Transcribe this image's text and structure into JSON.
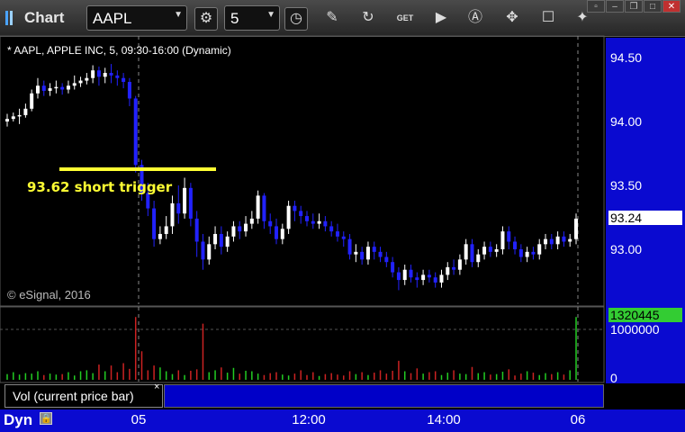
{
  "toolbar": {
    "app_title": "Chart",
    "symbol": "AAPL",
    "interval": "5"
  },
  "chart_title": "* AAPL, APPLE INC, 5, 09:30-16:00 (Dynamic)",
  "watermark": "© eSignal, 2016",
  "annotation": "93.62 short trigger",
  "price_axis": {
    "ticks": [
      "94.50",
      "94.00",
      "93.50",
      "93.00"
    ],
    "last_price": "93.24"
  },
  "volume_axis": {
    "ticks": [
      "1000000",
      "0"
    ],
    "last_volume": "1320445"
  },
  "volume_panel_label": "Vol (current price bar)",
  "volume_close": "×",
  "time_axis": {
    "ticks": [
      "05",
      "12:00",
      "14:00",
      "06"
    ]
  },
  "footer": {
    "dyn": "Dyn"
  },
  "colors": {
    "up": "#ffffff",
    "down": "#2222ff",
    "trigger_line": "#ffff33",
    "vol_up": "#22cc22",
    "vol_down": "#cc2222",
    "axis_bg": "#0a0ad0"
  },
  "chart_data": {
    "type": "candlestick",
    "title": "* AAPL, APPLE INC, 5, 09:30-16:00 (Dynamic)",
    "symbol": "AAPL",
    "interval": "5",
    "ylim": [
      92.6,
      94.6
    ],
    "yticks": [
      94.5,
      94.0,
      93.5,
      93.0
    ],
    "last_price": 93.24,
    "trigger": {
      "price": 93.62,
      "label": "93.62 short trigger"
    },
    "volume_last": 1320445,
    "volume_ticks": [
      1000000,
      0
    ],
    "time_ticks": [
      "05",
      "12:00",
      "14:00",
      "06"
    ],
    "candles": [
      [
        94.0,
        94.02,
        93.96,
        94.06
      ],
      [
        94.02,
        94.04,
        94.0,
        94.07
      ],
      [
        94.04,
        94.05,
        93.98,
        94.1
      ],
      [
        94.05,
        94.1,
        94.03,
        94.14
      ],
      [
        94.1,
        94.22,
        94.08,
        94.25
      ],
      [
        94.22,
        94.28,
        94.18,
        94.34
      ],
      [
        94.28,
        94.24,
        94.2,
        94.32
      ],
      [
        94.24,
        94.26,
        94.2,
        94.3
      ],
      [
        94.26,
        94.27,
        94.22,
        94.32
      ],
      [
        94.27,
        94.25,
        94.21,
        94.3
      ],
      [
        94.25,
        94.28,
        94.22,
        94.32
      ],
      [
        94.28,
        94.3,
        94.25,
        94.36
      ],
      [
        94.3,
        94.32,
        94.27,
        94.35
      ],
      [
        94.32,
        94.34,
        94.29,
        94.38
      ],
      [
        94.34,
        94.4,
        94.3,
        94.44
      ],
      [
        94.4,
        94.35,
        94.28,
        94.43
      ],
      [
        94.35,
        94.38,
        94.3,
        94.42
      ],
      [
        94.38,
        94.36,
        94.3,
        94.45
      ],
      [
        94.36,
        94.34,
        94.28,
        94.4
      ],
      [
        94.34,
        94.31,
        94.26,
        94.38
      ],
      [
        94.31,
        94.18,
        94.12,
        94.34
      ],
      [
        94.18,
        93.66,
        93.6,
        94.2
      ],
      [
        93.66,
        93.44,
        93.38,
        93.7
      ],
      [
        93.44,
        93.32,
        93.26,
        93.52
      ],
      [
        93.32,
        93.08,
        93.02,
        93.38
      ],
      [
        93.08,
        93.12,
        93.04,
        93.18
      ],
      [
        93.12,
        93.18,
        93.08,
        93.26
      ],
      [
        93.18,
        93.36,
        93.12,
        93.42
      ],
      [
        93.36,
        93.28,
        93.2,
        93.5
      ],
      [
        93.28,
        93.48,
        93.24,
        93.56
      ],
      [
        93.48,
        93.24,
        93.18,
        93.52
      ],
      [
        93.24,
        93.06,
        92.94,
        93.3
      ],
      [
        93.06,
        92.92,
        92.84,
        93.12
      ],
      [
        92.92,
        93.04,
        92.88,
        93.1
      ],
      [
        93.04,
        93.12,
        93.0,
        93.18
      ],
      [
        93.12,
        93.02,
        92.96,
        93.18
      ],
      [
        93.02,
        93.1,
        92.98,
        93.14
      ],
      [
        93.1,
        93.18,
        93.06,
        93.22
      ],
      [
        93.18,
        93.14,
        93.08,
        93.22
      ],
      [
        93.14,
        93.2,
        93.1,
        93.26
      ],
      [
        93.2,
        93.24,
        93.16,
        93.3
      ],
      [
        93.24,
        93.42,
        93.2,
        93.46
      ],
      [
        93.42,
        93.22,
        93.16,
        93.44
      ],
      [
        93.22,
        93.18,
        93.12,
        93.28
      ],
      [
        93.18,
        93.08,
        93.04,
        93.24
      ],
      [
        93.08,
        93.16,
        93.04,
        93.2
      ],
      [
        93.16,
        93.34,
        93.12,
        93.38
      ],
      [
        93.34,
        93.3,
        93.22,
        93.38
      ],
      [
        93.3,
        93.26,
        93.2,
        93.34
      ],
      [
        93.26,
        93.22,
        93.18,
        93.3
      ],
      [
        93.22,
        93.2,
        93.16,
        93.28
      ],
      [
        93.2,
        93.22,
        93.16,
        93.28
      ],
      [
        93.22,
        93.18,
        93.14,
        93.26
      ],
      [
        93.18,
        93.14,
        93.1,
        93.22
      ],
      [
        93.14,
        93.1,
        93.06,
        93.2
      ],
      [
        93.1,
        93.08,
        93.02,
        93.14
      ],
      [
        93.08,
        92.96,
        92.92,
        93.12
      ],
      [
        92.96,
        92.98,
        92.9,
        93.04
      ],
      [
        92.98,
        92.92,
        92.88,
        93.02
      ],
      [
        92.92,
        93.02,
        92.88,
        93.06
      ],
      [
        93.02,
        92.98,
        92.92,
        93.06
      ],
      [
        92.98,
        92.94,
        92.9,
        93.02
      ],
      [
        92.94,
        92.9,
        92.86,
        92.98
      ],
      [
        92.9,
        92.82,
        92.78,
        92.94
      ],
      [
        92.82,
        92.76,
        92.68,
        92.86
      ],
      [
        92.76,
        92.84,
        92.72,
        92.88
      ],
      [
        92.84,
        92.78,
        92.74,
        92.88
      ],
      [
        92.78,
        92.76,
        92.7,
        92.82
      ],
      [
        92.76,
        92.8,
        92.72,
        92.84
      ],
      [
        92.8,
        92.78,
        92.74,
        92.84
      ],
      [
        92.78,
        92.74,
        92.7,
        92.82
      ],
      [
        92.74,
        92.8,
        92.7,
        92.84
      ],
      [
        92.8,
        92.86,
        92.76,
        92.9
      ],
      [
        92.86,
        92.84,
        92.8,
        92.92
      ],
      [
        92.84,
        92.92,
        92.8,
        92.96
      ],
      [
        92.92,
        93.04,
        92.88,
        93.08
      ],
      [
        93.04,
        92.9,
        92.86,
        93.08
      ],
      [
        92.9,
        92.96,
        92.86,
        93.0
      ],
      [
        92.96,
        93.02,
        92.92,
        93.06
      ],
      [
        93.02,
        92.98,
        92.94,
        93.06
      ],
      [
        92.98,
        93.0,
        92.94,
        93.04
      ],
      [
        93.0,
        93.14,
        92.96,
        93.18
      ],
      [
        93.14,
        93.06,
        93.0,
        93.18
      ],
      [
        93.06,
        93.0,
        92.96,
        93.1
      ],
      [
        93.0,
        92.94,
        92.9,
        93.04
      ],
      [
        92.94,
        92.98,
        92.9,
        93.02
      ],
      [
        92.98,
        92.96,
        92.92,
        93.02
      ],
      [
        92.96,
        93.04,
        92.92,
        93.08
      ],
      [
        93.04,
        93.08,
        93.0,
        93.12
      ],
      [
        93.08,
        93.04,
        93.0,
        93.12
      ],
      [
        93.04,
        93.1,
        93.0,
        93.14
      ],
      [
        93.1,
        93.06,
        93.02,
        93.14
      ],
      [
        93.06,
        93.08,
        93.02,
        93.12
      ],
      [
        93.08,
        93.24,
        93.04,
        93.28
      ]
    ],
    "volumes": [
      120000,
      160000,
      110000,
      140000,
      130000,
      180000,
      100000,
      130000,
      110000,
      120000,
      160000,
      90000,
      180000,
      200000,
      140000,
      320000,
      180000,
      300000,
      160000,
      350000,
      230000,
      1320000,
      600000,
      200000,
      300000,
      260000,
      180000,
      120000,
      200000,
      100000,
      190000,
      220000,
      1180000,
      160000,
      200000,
      260000,
      150000,
      250000,
      130000,
      190000,
      180000,
      130000,
      100000,
      140000,
      160000,
      110000,
      90000,
      130000,
      200000,
      100000,
      160000,
      80000,
      120000,
      140000,
      110000,
      90000,
      180000,
      120000,
      160000,
      100000,
      150000,
      200000,
      130000,
      190000,
      400000,
      180000,
      140000,
      240000,
      130000,
      160000,
      180000,
      100000,
      150000,
      200000,
      130000,
      120000,
      270000,
      140000,
      160000,
      110000,
      120000,
      170000,
      220000,
      90000,
      130000,
      180000,
      150000,
      100000,
      140000,
      120000,
      160000,
      110000,
      200000,
      1320445
    ]
  }
}
